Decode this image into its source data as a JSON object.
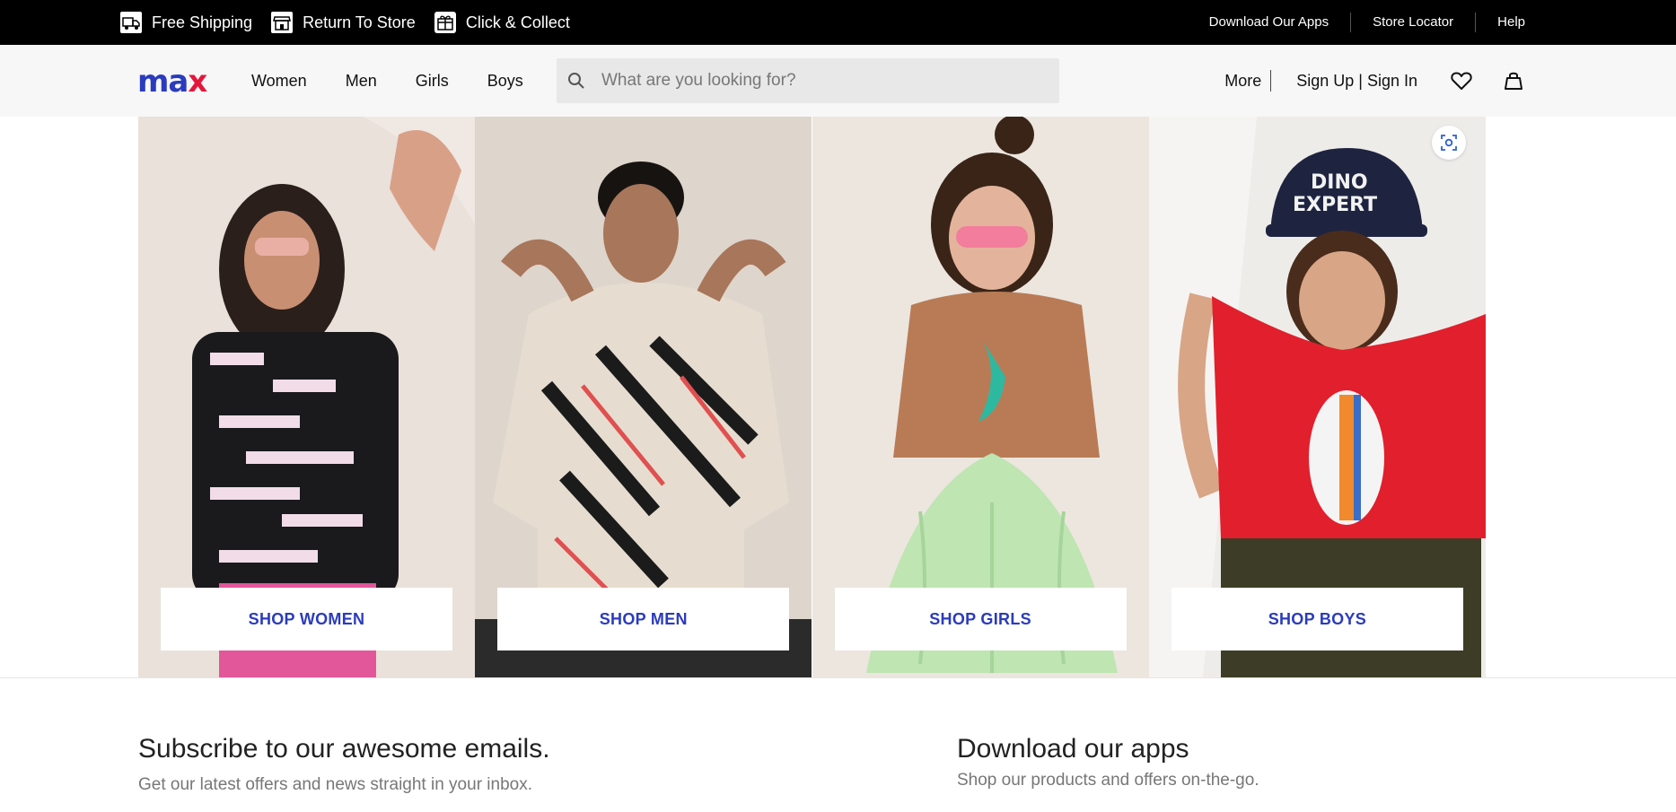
{
  "topbar": {
    "perks": [
      {
        "label": "Free Shipping",
        "icon": "truck-icon"
      },
      {
        "label": "Return To Store",
        "icon": "store-icon"
      },
      {
        "label": "Click & Collect",
        "icon": "gift-box-icon"
      }
    ],
    "links": [
      "Download Our Apps",
      "Store Locator",
      "Help"
    ]
  },
  "header": {
    "logo": {
      "m": "ma",
      "x": "x"
    },
    "nav": [
      "Women",
      "Men",
      "Girls",
      "Boys"
    ],
    "search": {
      "placeholder": "What are you looking for?",
      "value": ""
    },
    "more": "More",
    "sign": "Sign Up | Sign In",
    "icons": [
      "heart-icon",
      "bag-icon"
    ]
  },
  "hero": {
    "tiles": [
      {
        "button": "SHOP WOMEN"
      },
      {
        "button": "SHOP MEN"
      },
      {
        "button": "SHOP GIRLS"
      },
      {
        "button": "SHOP BOYS"
      }
    ],
    "lens_icon": "visual-search-icon"
  },
  "subscribe": {
    "title": "Subscribe to our awesome emails.",
    "text": "Get our latest offers and news straight in your inbox."
  },
  "apps": {
    "title": "Download our apps",
    "text": "Shop our products and offers on-the-go."
  },
  "colors": {
    "brand_blue": "#2b3bbd",
    "brand_red": "#e4173a",
    "topbar_bg": "#000000",
    "header_bg": "#f7f7f7"
  }
}
